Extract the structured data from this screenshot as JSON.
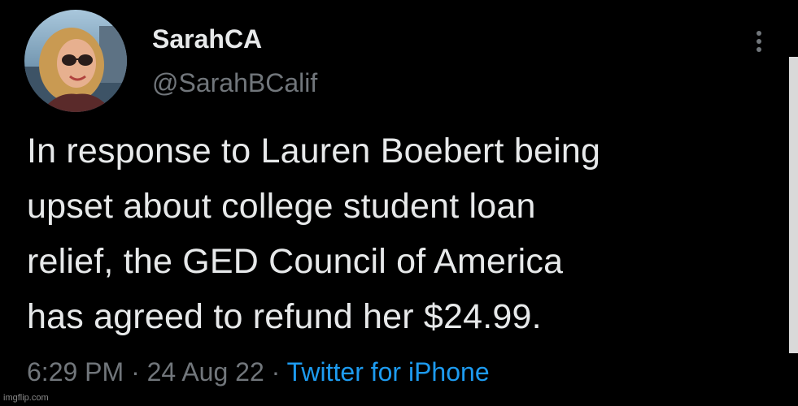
{
  "tweet": {
    "author": {
      "display_name": "SarahCA",
      "handle": "@SarahBCalif"
    },
    "text_lines": [
      "In response to Lauren Boebert being",
      "upset about college student loan",
      "relief, the GED Council of America",
      "has agreed to refund her $24.99."
    ],
    "time": "6:29 PM",
    "separator": "·",
    "date": "24 Aug 22",
    "source": "Twitter for iPhone"
  },
  "watermark": "imgflip.com",
  "colors": {
    "background": "#000000",
    "primary_text": "#e7e9ea",
    "secondary_text": "#71767b",
    "link": "#1d9bf0"
  },
  "icons": {
    "more": "more-vertical-icon"
  }
}
